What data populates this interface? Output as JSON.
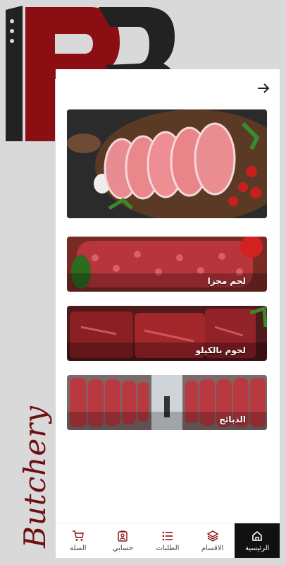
{
  "brand": {
    "script_word": "Butchery",
    "accent_color": "#8b0e12",
    "dark_color": "#222222"
  },
  "header": {
    "back_icon": "arrow-right-icon"
  },
  "hero": {
    "image": "raw-meat-steaks-on-board"
  },
  "categories": [
    {
      "label": "لحم مجزا",
      "image": "minced-meat"
    },
    {
      "label": "لحوم بالكيلو",
      "image": "beef-chunks"
    },
    {
      "label": "الذبائح",
      "image": "carcasses-cold-room"
    }
  ],
  "nav": {
    "items": [
      {
        "label": "الرئيسية",
        "icon": "home-icon",
        "active": true
      },
      {
        "label": "الاقسام",
        "icon": "layers-icon",
        "active": false
      },
      {
        "label": "الطلبات",
        "icon": "list-icon",
        "active": false
      },
      {
        "label": "حسابي",
        "icon": "profile-icon",
        "active": false
      },
      {
        "label": "السلة",
        "icon": "cart-icon",
        "active": false
      }
    ]
  }
}
